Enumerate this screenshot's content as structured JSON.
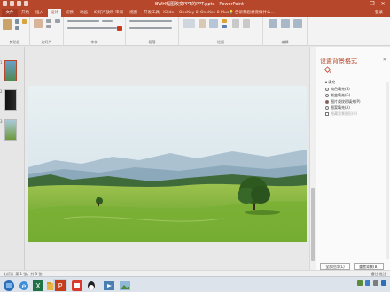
{
  "window": {
    "title": "BWH幅图改变PPT的PPT.pptx - PowerPoint",
    "controls": [
      "—",
      "❐",
      "✕"
    ]
  },
  "ribbon_tabs": [
    {
      "label": "文件",
      "active": false
    },
    {
      "label": "开始",
      "active": false
    },
    {
      "label": "插入",
      "active": false
    },
    {
      "label": "设计",
      "active": true
    },
    {
      "label": "切换",
      "active": false
    },
    {
      "label": "动画",
      "active": false
    },
    {
      "label": "幻灯片放映",
      "active": false
    },
    {
      "label": "审阅",
      "active": false
    },
    {
      "label": "视图",
      "active": false
    },
    {
      "label": "开发工具",
      "active": false
    },
    {
      "label": "iSlide",
      "active": false
    },
    {
      "label": "OneKey 8",
      "active": false
    },
    {
      "label": "OneKey 8 Plus",
      "active": false
    }
  ],
  "tell_me": "告诉我您想要做什么...",
  "user": "登录",
  "ribbon_groups": [
    "剪贴板",
    "幻灯片",
    "字体",
    "段落",
    "绘图",
    "编辑"
  ],
  "format_panel": {
    "title": "设置背景格式",
    "section": "填充",
    "options": [
      {
        "label": "纯色填充(S)",
        "checked": false
      },
      {
        "label": "渐变填充(G)",
        "checked": false
      },
      {
        "label": "图片或纹理填充(P)",
        "checked": true
      },
      {
        "label": "图案填充(A)",
        "checked": false
      },
      {
        "label": "隐藏背景图形(H)",
        "checked": false
      }
    ],
    "apply_all": "全部应用(L)",
    "reset": "重置背景(B)"
  },
  "status": {
    "left": "幻灯片 第 1 张，共 3 张",
    "right": "备注  批注"
  },
  "colors": {
    "accent": "#b7472a",
    "ribbon": "#f3f3f3"
  },
  "taskbar_apps": [
    "start-icon",
    "ie-icon",
    "explorer-icon",
    "excel-icon",
    "powerpoint-icon",
    "wps-icon",
    "qq-icon",
    "photo-icon"
  ]
}
